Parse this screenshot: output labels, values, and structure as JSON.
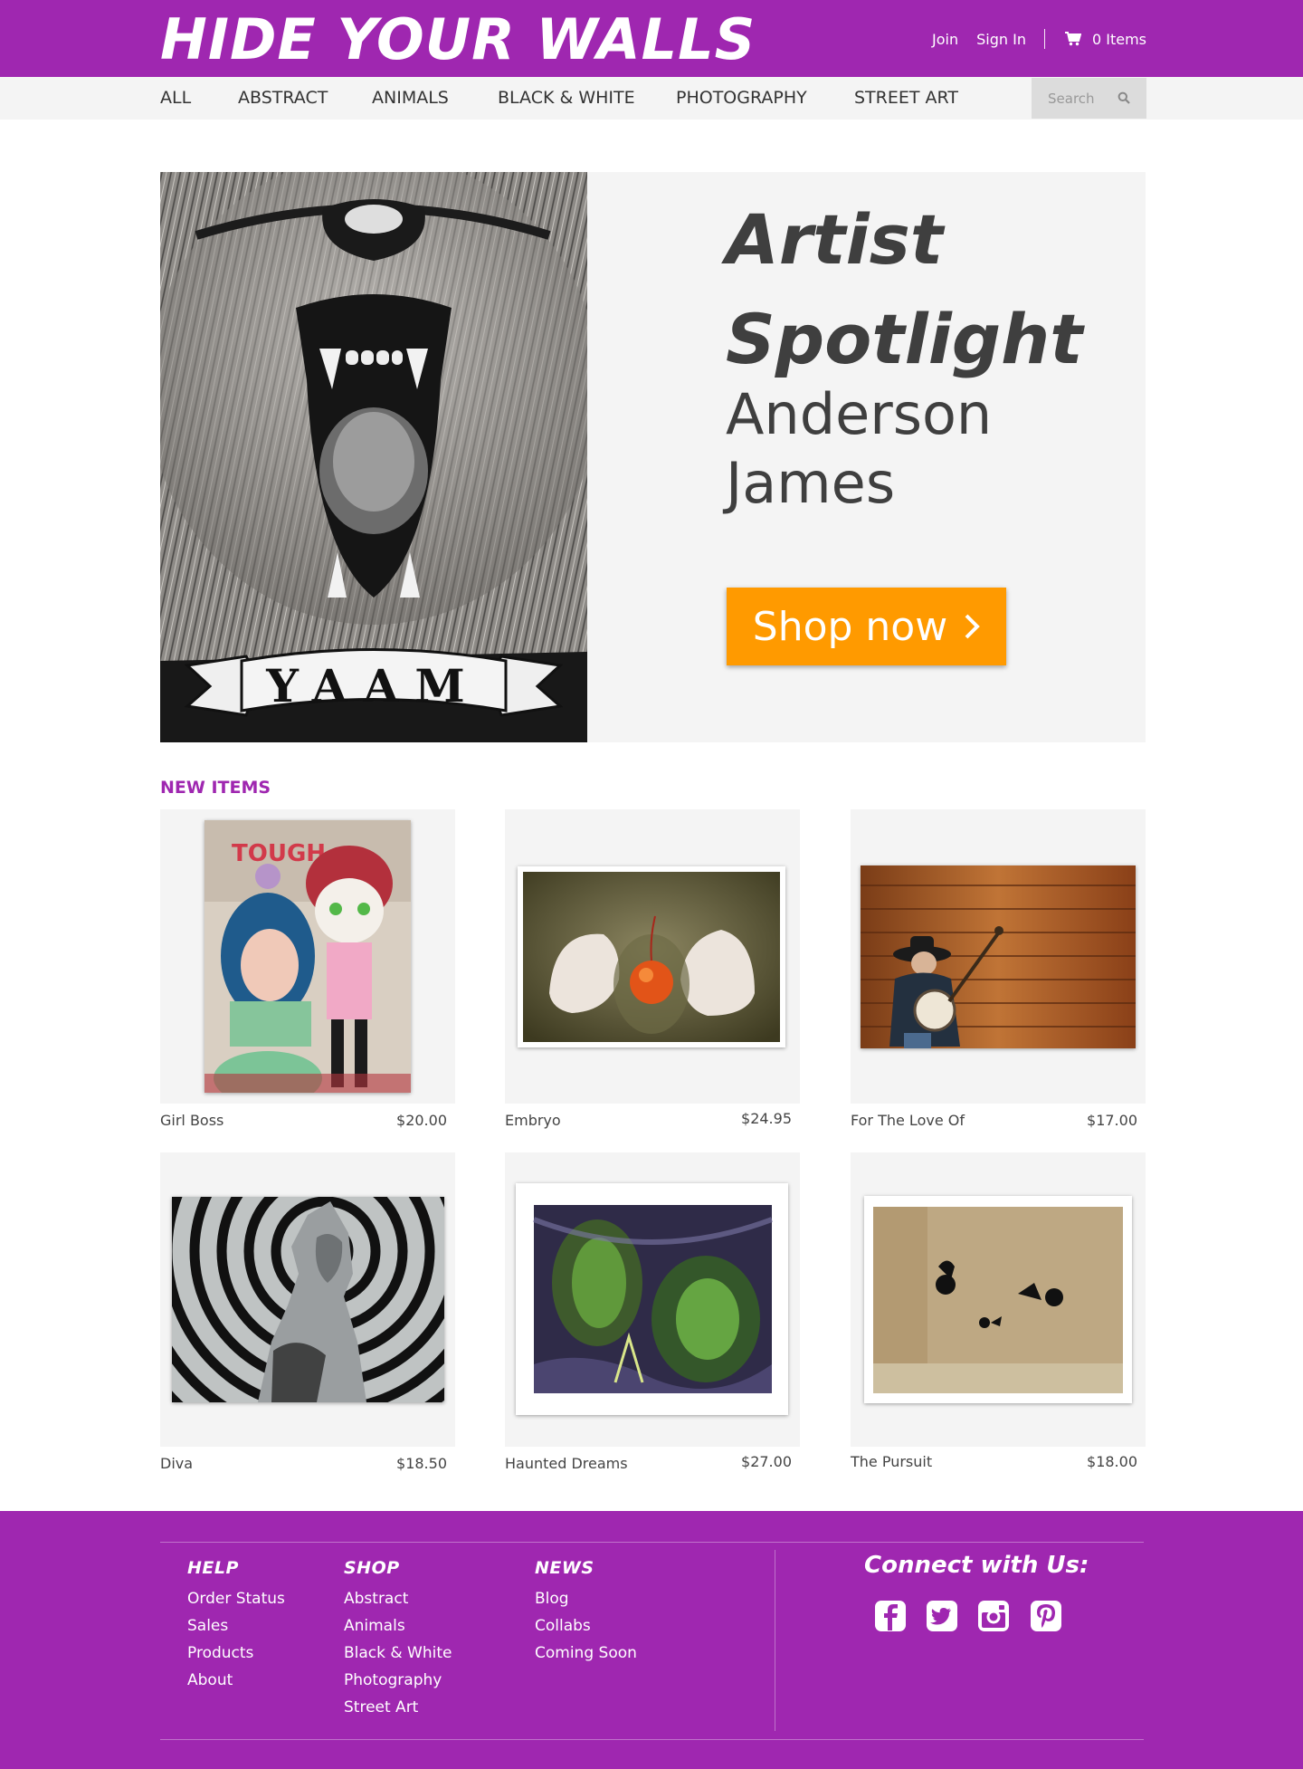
{
  "brand": {
    "logo": "HIDE YOUR WALLS",
    "color": "#9f27b0",
    "accent": "#ff9a00"
  },
  "header": {
    "join": "Join",
    "sign_in": "Sign In",
    "cart_icon": "shopping-cart-icon",
    "cart_label": "0 Items"
  },
  "categories": [
    "ALL",
    "ABSTRACT",
    "ANIMALS",
    "BLACK & WHITE",
    "PHOTOGRAPHY",
    "STREET ART"
  ],
  "search": {
    "placeholder": "Search",
    "icon": "search-icon"
  },
  "hero": {
    "title_line1": "Artist",
    "title_line2": "Spotlight",
    "artist_line1": "Anderson",
    "artist_line2": "James",
    "button_label": "Shop now",
    "image_banner_text": "YAAM"
  },
  "new_items": {
    "title": "NEW ITEMS",
    "items": [
      {
        "name": "Girl Boss",
        "price": "$20.00"
      },
      {
        "name": "Embryo",
        "price": "$24.95"
      },
      {
        "name": "For The Love Of",
        "price": "$17.00"
      },
      {
        "name": "Diva",
        "price": "$18.50"
      },
      {
        "name": "Haunted Dreams",
        "price": "$27.00"
      },
      {
        "name": "The Pursuit",
        "price": "$18.00"
      }
    ]
  },
  "footer": {
    "help": {
      "title": "HELP",
      "links": [
        "Order Status",
        "Sales",
        "Products",
        "About"
      ]
    },
    "shop": {
      "title": "SHOP",
      "links": [
        "Abstract",
        "Animals",
        "Black & White",
        "Photography",
        "Street Art"
      ]
    },
    "news": {
      "title": "NEWS",
      "links": [
        "Blog",
        "Collabs",
        "Coming Soon"
      ]
    },
    "connect": "Connect with Us:",
    "social_icons": [
      "facebook-icon",
      "twitter-icon",
      "instagram-icon",
      "pinterest-icon"
    ]
  }
}
